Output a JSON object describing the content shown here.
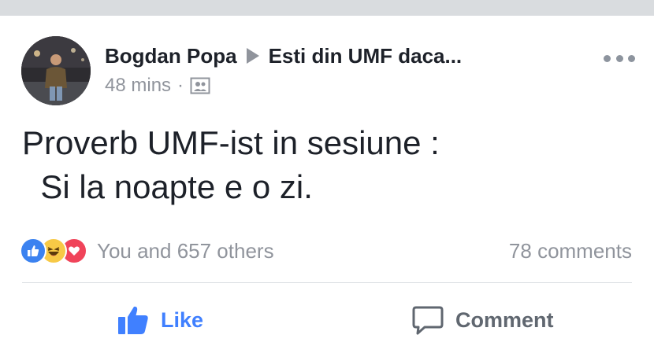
{
  "post": {
    "author": "Bogdan Popa",
    "group": "Esti din UMF daca...",
    "time": "48 mins",
    "separator": "·",
    "text": "Proverb UMF-ist in sesiune :\n  Si la noapte e o zi."
  },
  "reactions": {
    "summary": "You and 657 others",
    "types": [
      "like-icon",
      "haha-icon",
      "love-icon"
    ]
  },
  "comments": {
    "count_label": "78 comments"
  },
  "actions": {
    "like_label": "Like",
    "comment_label": "Comment"
  },
  "colors": {
    "link_blue": "#4080ff",
    "muted": "#90949c",
    "text": "#1d2129"
  }
}
